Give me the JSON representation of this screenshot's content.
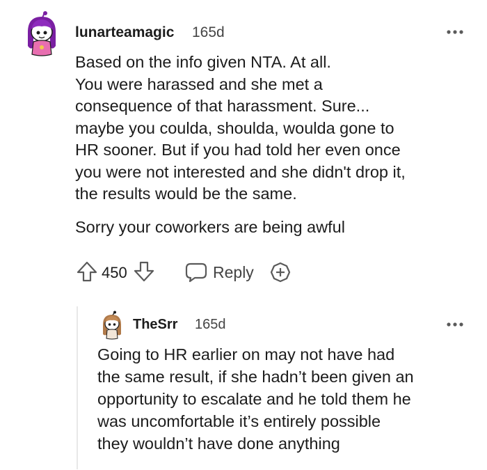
{
  "comment": {
    "username": "lunarteamagic",
    "age": "165d",
    "body_lines": {
      "p1": "Based on the info given NTA. At all.\nYou were harassed and she met a\nconsequence of that harassment. Sure...\nmaybe you coulda, shoulda, woulda gone to\nHR sooner. But if you had told her even once\nyou were not interested and she didn't drop it,\nthe results would be the same.",
      "p2": "Sorry your coworkers are being awful"
    },
    "votes": "450",
    "reply_label": "Reply",
    "avatar_icon": "snoo-avatar-purple-hair",
    "more_icon": "more-options-icon"
  },
  "reply": {
    "username": "TheSrr",
    "age": "165d",
    "body": "Going to HR earlier on may not have had\nthe same result, if she hadn’t been given an\nopportunity to escalate and he told them he\nwas uncomfortable it’s entirely possible\nthey wouldn’t have done anything",
    "avatar_icon": "snoo-avatar-brown-hair",
    "more_icon": "more-options-icon"
  },
  "colors": {
    "text": "#1c1c1c",
    "meta": "#444444",
    "icon": "#5a5a5a",
    "thread_line": "#e8e8e8",
    "avatar_main_hair": "#7a1fa2",
    "avatar_main_body": "#e86fb0",
    "avatar_reply_hair": "#b07a4a"
  }
}
